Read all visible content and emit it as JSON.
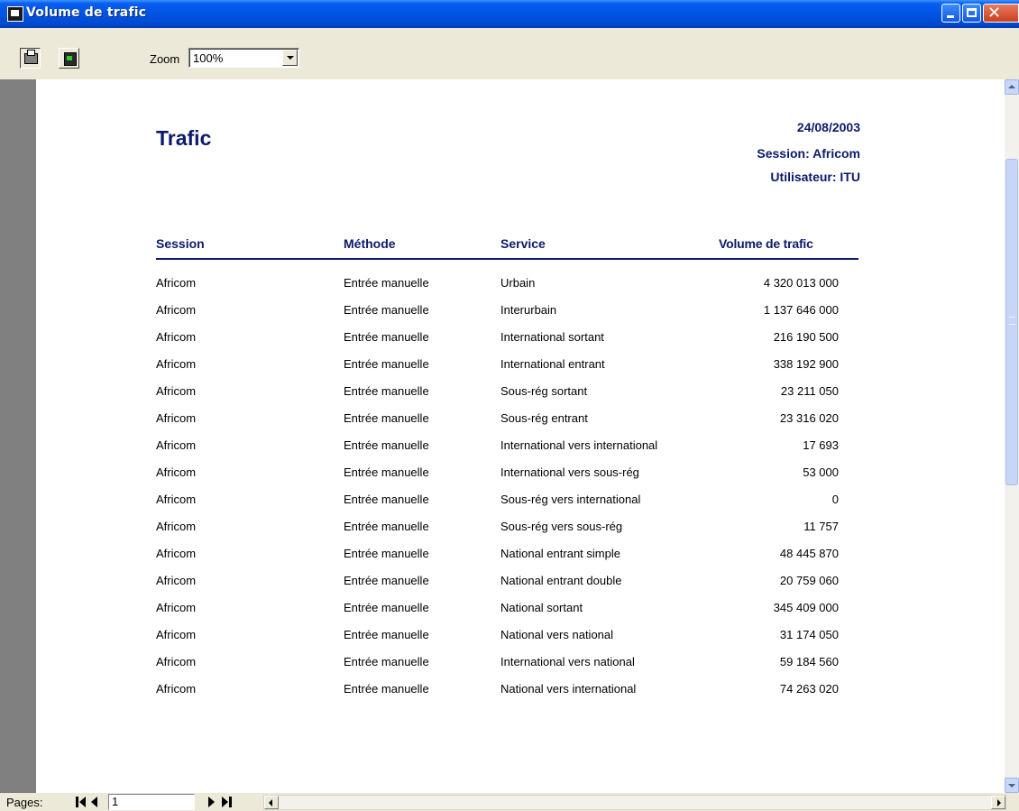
{
  "window": {
    "title": "Volume de trafic"
  },
  "toolbar": {
    "zoom_label": "Zoom",
    "zoom_value": "100%"
  },
  "report": {
    "title": "Trafic",
    "date": "24/08/2003",
    "session": "Session: Africom",
    "user": "Utilisateur: ITU",
    "columns": [
      "Session",
      "Méthode",
      "Service",
      "Volume de trafic"
    ],
    "rows": [
      [
        "Africom",
        "Entrée manuelle",
        "Urbain",
        "4 320 013 000"
      ],
      [
        "Africom",
        "Entrée manuelle",
        "Interurbain",
        "1 137 646 000"
      ],
      [
        "Africom",
        "Entrée manuelle",
        "International sortant",
        "216 190 500"
      ],
      [
        "Africom",
        "Entrée manuelle",
        "International entrant",
        "338 192 900"
      ],
      [
        "Africom",
        "Entrée manuelle",
        "Sous-rég sortant",
        "23 211 050"
      ],
      [
        "Africom",
        "Entrée manuelle",
        "Sous-rég entrant",
        "23 316 020"
      ],
      [
        "Africom",
        "Entrée manuelle",
        "International vers international",
        "17 693"
      ],
      [
        "Africom",
        "Entrée manuelle",
        "International vers sous-rég",
        "53 000"
      ],
      [
        "Africom",
        "Entrée manuelle",
        "Sous-rég vers international",
        "0"
      ],
      [
        "Africom",
        "Entrée manuelle",
        "Sous-rég vers sous-rég",
        "11 757"
      ],
      [
        "Africom",
        "Entrée manuelle",
        "National entrant simple",
        "48 445 870"
      ],
      [
        "Africom",
        "Entrée manuelle",
        "National entrant double",
        "20 759 060"
      ],
      [
        "Africom",
        "Entrée manuelle",
        "National sortant",
        "345 409 000"
      ],
      [
        "Africom",
        "Entrée manuelle",
        "National vers national",
        "31 174 050"
      ],
      [
        "Africom",
        "Entrée manuelle",
        "International vers national",
        "59 184 560"
      ],
      [
        "Africom",
        "Entrée manuelle",
        "National vers international",
        "74 263 020"
      ]
    ]
  },
  "navigation": {
    "pages_label": "Pages:",
    "current_page": "1"
  },
  "icons": {
    "app": "report-window-icon",
    "print": "printer-icon",
    "setup": "page-setup-icon",
    "first": "first-page-icon",
    "prev": "previous-page-icon",
    "next": "next-page-icon",
    "last": "last-page-icon"
  },
  "colors": {
    "titlebar": "#0054e3",
    "report_heading": "#0c1a6b",
    "gutter": "#808080"
  }
}
